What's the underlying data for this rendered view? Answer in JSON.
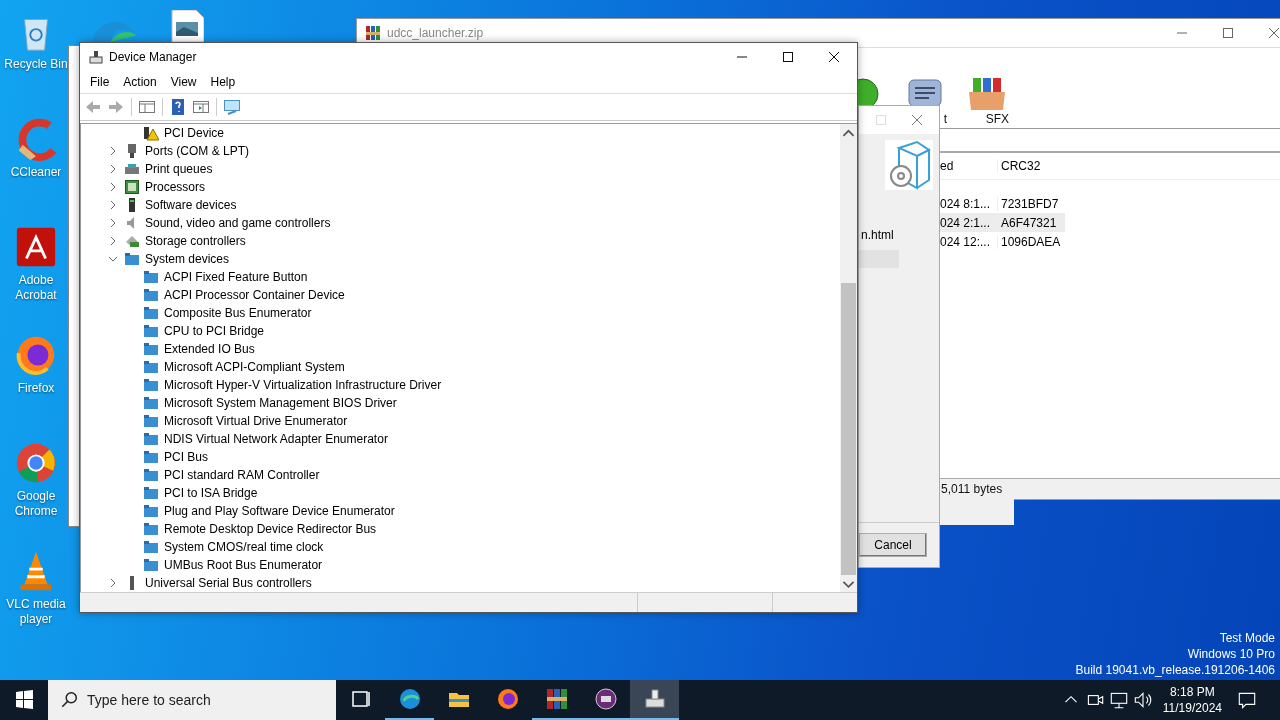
{
  "desktop_icons": [
    {
      "label": "Recycle Bin",
      "kind": "recycle"
    },
    {
      "label": "CCleaner",
      "kind": "ccleaner"
    },
    {
      "label": "Adobe Acrobat",
      "kind": "acrobat"
    },
    {
      "label": "Firefox",
      "kind": "firefox"
    },
    {
      "label": "Google Chrome",
      "kind": "chrome"
    },
    {
      "label": "VLC media player",
      "kind": "vlc"
    }
  ],
  "archive_window": {
    "title": "udcc_launcher.zip",
    "toolbar": [
      {
        "kind": "green"
      },
      {
        "kind": "comment",
        "label": "t"
      },
      {
        "kind": "sfx",
        "label": "SFX"
      }
    ],
    "columns": [
      "ed",
      "CRC32"
    ],
    "rows": [
      {
        "cells": [
          "024 8:1...",
          "7231BFD7"
        ],
        "selected": false
      },
      {
        "cells": [
          "024 2:1...",
          "A6F47321"
        ],
        "selected": true
      },
      {
        "cells": [
          "024 12:...",
          "1096DAEA"
        ],
        "selected": false
      }
    ],
    "status": "5,011 bytes"
  },
  "extract_dialog": {
    "file": "n.html",
    "button": "Cancel"
  },
  "device_manager": {
    "title": "Device Manager",
    "menu": [
      "File",
      "Action",
      "View",
      "Help"
    ],
    "tree": [
      {
        "expanded": true,
        "children": [
          {
            "label": "PCI Device",
            "kind": "warning"
          }
        ]
      },
      {
        "label": "Ports (COM & LPT)",
        "kind": "ports",
        "expanded": false
      },
      {
        "label": "Print queues",
        "kind": "printer",
        "expanded": false
      },
      {
        "label": "Processors",
        "kind": "processor",
        "expanded": false
      },
      {
        "label": "Software devices",
        "kind": "software",
        "expanded": false
      },
      {
        "label": "Sound, video and game controllers",
        "kind": "sound",
        "expanded": false
      },
      {
        "label": "Storage controllers",
        "kind": "storage",
        "expanded": false
      },
      {
        "label": "System devices",
        "kind": "system",
        "expanded": true,
        "children": [
          {
            "label": "ACPI Fixed Feature Button",
            "kind": "system"
          },
          {
            "label": "ACPI Processor Container Device",
            "kind": "system"
          },
          {
            "label": "Composite Bus Enumerator",
            "kind": "system"
          },
          {
            "label": "CPU to PCI Bridge",
            "kind": "system"
          },
          {
            "label": "Extended IO Bus",
            "kind": "system"
          },
          {
            "label": "Microsoft ACPI-Compliant System",
            "kind": "system"
          },
          {
            "label": "Microsoft Hyper-V Virtualization Infrastructure Driver",
            "kind": "system"
          },
          {
            "label": "Microsoft System Management BIOS Driver",
            "kind": "system"
          },
          {
            "label": "Microsoft Virtual Drive Enumerator",
            "kind": "system"
          },
          {
            "label": "NDIS Virtual Network Adapter Enumerator",
            "kind": "system"
          },
          {
            "label": "PCI Bus",
            "kind": "system"
          },
          {
            "label": "PCI standard RAM Controller",
            "kind": "system"
          },
          {
            "label": "PCI to ISA Bridge",
            "kind": "system"
          },
          {
            "label": "Plug and Play Software Device Enumerator",
            "kind": "system"
          },
          {
            "label": "Remote Desktop Device Redirector Bus",
            "kind": "system"
          },
          {
            "label": "System CMOS/real time clock",
            "kind": "system"
          },
          {
            "label": "UMBus Root Bus Enumerator",
            "kind": "system"
          }
        ]
      },
      {
        "label": "Universal Serial Bus controllers",
        "kind": "usb",
        "expanded": false
      }
    ]
  },
  "taskbar": {
    "search": {
      "placeholder": "Type here to search"
    },
    "apps": [
      {
        "kind": "taskview",
        "running": false,
        "active": false
      },
      {
        "kind": "edge",
        "running": true,
        "active": false
      },
      {
        "kind": "explorer",
        "running": false,
        "active": false
      },
      {
        "kind": "firefox",
        "running": false,
        "active": false
      },
      {
        "kind": "winrar",
        "running": true,
        "active": false
      },
      {
        "kind": "purple",
        "running": true,
        "active": false
      },
      {
        "kind": "devmgr",
        "running": true,
        "active": true
      }
    ],
    "time": "8:18 PM",
    "date": "11/19/2024"
  },
  "system_notice": [
    "Test Mode",
    "Windows 10 Pro",
    "Build 19041.vb_release.191206-1406"
  ]
}
